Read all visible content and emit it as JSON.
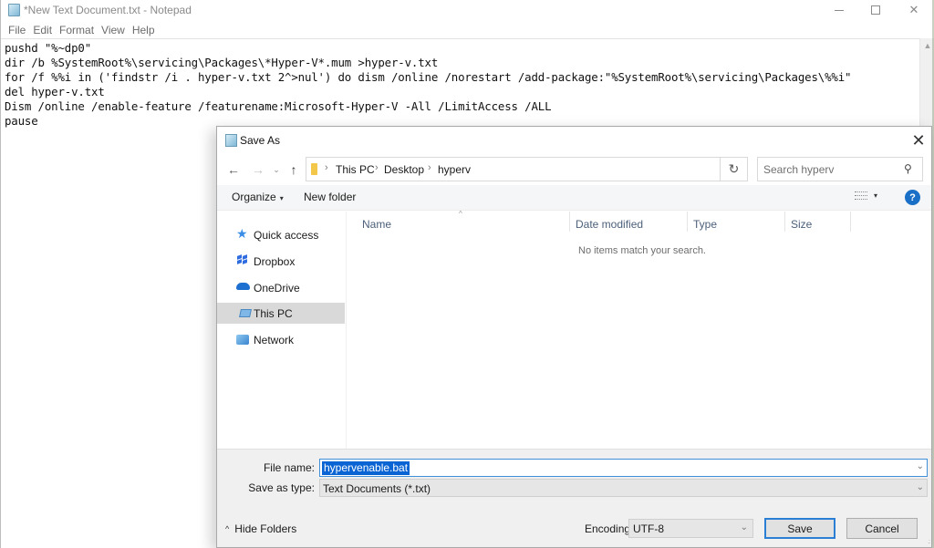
{
  "notepad": {
    "title": "*New Text Document.txt - Notepad",
    "window_controls": {
      "minimize": "minimize-icon",
      "maximize": "maximize-icon",
      "close": "close-icon"
    },
    "menu": [
      "File",
      "Edit",
      "Format",
      "View",
      "Help"
    ],
    "lines": [
      "pushd \"%~dp0\"",
      "dir /b %SystemRoot%\\servicing\\Packages\\*Hyper-V*.mum >hyper-v.txt",
      "for /f %%i in ('findstr /i . hyper-v.txt 2^>nul') do dism /online /norestart /add-package:\"%SystemRoot%\\servicing\\Packages\\%%i\"",
      "del hyper-v.txt",
      "Dism /online /enable-feature /featurename:Microsoft-Hyper-V -All /LimitAccess /ALL",
      "pause"
    ]
  },
  "dialog": {
    "title": "Save As",
    "close_glyph": "✕",
    "nav": {
      "back": "←",
      "forward": "→",
      "recent": "⌄",
      "up": "↑"
    },
    "breadcrumb": [
      "This PC",
      "Desktop",
      "hyperv"
    ],
    "breadcrumb_sep": "›",
    "address_dropdown": "⌄",
    "refresh": "↻",
    "search": {
      "placeholder": "Search hyperv",
      "icon": "⚲"
    },
    "toolbar": {
      "organize": "Organize",
      "organize_caret": "▾",
      "new_folder": "New folder",
      "view_caret": "▾",
      "help": "?"
    },
    "nav_pane": [
      {
        "label": "Quick access",
        "icon": "quick-access-icon",
        "selected": false
      },
      {
        "label": "Dropbox",
        "icon": "dropbox-icon",
        "selected": false
      },
      {
        "label": "OneDrive",
        "icon": "onedrive-icon",
        "selected": false
      },
      {
        "label": "This PC",
        "icon": "this-pc-icon",
        "selected": true
      },
      {
        "label": "Network",
        "icon": "network-icon",
        "selected": false
      }
    ],
    "columns": [
      "Name",
      "Date modified",
      "Type",
      "Size"
    ],
    "sort_caret": "^",
    "empty_message": "No items match your search.",
    "file_name_label": "File name:",
    "file_name_value": "hypervenable.bat",
    "save_as_type_label": "Save as type:",
    "save_as_type_value": "Text Documents (*.txt)",
    "dropdown_glyph": "⌄",
    "hide_folders": "Hide Folders",
    "hide_folders_caret": "^",
    "encoding_label": "Encoding:",
    "encoding_value": "UTF-8",
    "save_button": "Save",
    "cancel_button": "Cancel"
  }
}
